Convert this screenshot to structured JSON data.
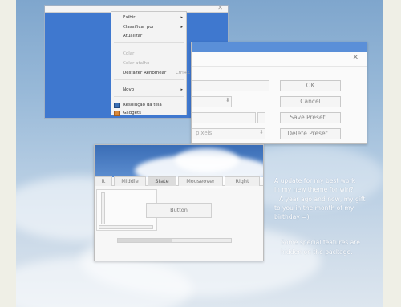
{
  "context_menu": {
    "items": [
      {
        "label": "Exibir",
        "arrow": "▸"
      },
      {
        "label": "Classificar por",
        "arrow": "▸"
      },
      {
        "label": "Atualizar"
      },
      {
        "label": "Colar",
        "disabled": true
      },
      {
        "label": "Colar atalho",
        "disabled": true
      },
      {
        "label": "Desfazer Renomear",
        "shortcut": "Ctrl+Z"
      },
      {
        "label": "Novo",
        "arrow": "▸"
      },
      {
        "label": "Resolução da tela"
      },
      {
        "label": "Gadgets"
      }
    ]
  },
  "dialog": {
    "close_icon": "✕",
    "buttons": {
      "ok": "OK",
      "cancel": "Cancel",
      "save_preset": "Save Preset...",
      "delete_preset": "Delete Preset..."
    },
    "units_value": "pixels",
    "spinner_arrows": "⬍"
  },
  "preview": {
    "tabs": [
      "ft",
      "Middle",
      "State",
      "Mouseover",
      "Right"
    ],
    "selected_tab": "State",
    "button_label": "Button",
    "scroll_arrows": {
      "up": "▴",
      "down": "▾",
      "left": "◂",
      "right": "▸"
    },
    "progress": 0.48
  },
  "note": {
    "lines": [
      "A update for my best work",
      "in my new theme for win?",
      "  A year ago and now, my gift",
      "to you in the month of my",
      "birthday =)",
      "",
      "Some special features are",
      "hidden on the package."
    ]
  },
  "colors": {
    "desktop_blue": "#3f78cf",
    "sky_top": "#7fa6cd",
    "note_text": "#ffffff"
  }
}
